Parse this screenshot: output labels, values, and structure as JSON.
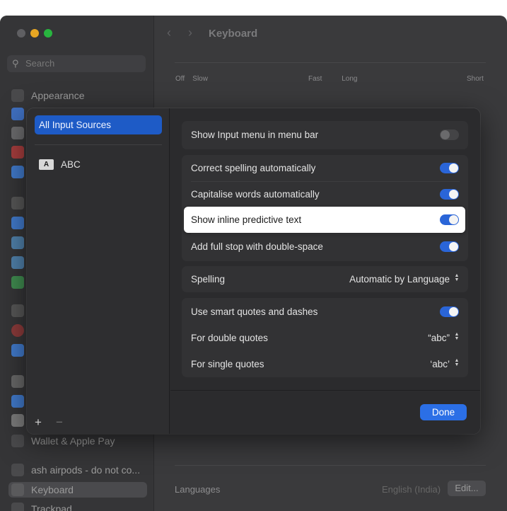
{
  "window": {
    "title": "Keyboard"
  },
  "background_sidebar": {
    "search_placeholder": "Search",
    "items": [
      {
        "label": "Appearance",
        "color": "#555"
      },
      {
        "label": "Wallet & Apple Pay",
        "color": "#555"
      },
      {
        "label": "ash airpods - do not co...",
        "color": "#555"
      },
      {
        "label": "Keyboard",
        "color": "#555"
      },
      {
        "label": "Trackpad",
        "color": "#555"
      }
    ]
  },
  "background_main": {
    "slider_labels_left": [
      "Off",
      "Slow"
    ],
    "slider_labels_mid": [
      "Fast",
      "Long"
    ],
    "slider_labels_right": "Short",
    "languages_label": "Languages",
    "languages_value": "English (India)",
    "edit_button": "Edit..."
  },
  "sheet": {
    "input_sources_header": "All Input Sources",
    "sources": [
      {
        "badge": "A",
        "label": "ABC"
      }
    ],
    "add_button": "+",
    "remove_button": "−",
    "settings": {
      "show_input_menu": {
        "label": "Show Input menu in menu bar",
        "enabled": false
      },
      "correct_spelling": {
        "label": "Correct spelling automatically",
        "enabled": true
      },
      "capitalise_words": {
        "label": "Capitalise words automatically",
        "enabled": true
      },
      "inline_predictive": {
        "label": "Show inline predictive text",
        "enabled": true
      },
      "full_stop": {
        "label": "Add full stop with double-space",
        "enabled": true
      },
      "spelling": {
        "label": "Spelling",
        "value": "Automatic by Language"
      },
      "smart_quotes": {
        "label": "Use smart quotes and dashes",
        "enabled": true
      },
      "double_quotes": {
        "label": "For double quotes",
        "value": "“abc”"
      },
      "single_quotes": {
        "label": "For single quotes",
        "value": "‘abc’"
      }
    },
    "done_button": "Done"
  },
  "colors": {
    "accent": "#2a65d8",
    "selection": "#1e5bc6",
    "done": "#2b6fe6"
  }
}
